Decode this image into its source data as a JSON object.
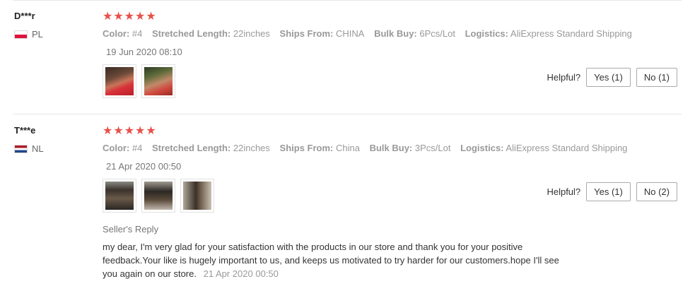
{
  "reviews": [
    {
      "user": "D***r",
      "country": "PL",
      "rating_stars": "★★★★★",
      "rating": 5,
      "attributes": [
        {
          "key": "Color:",
          "value": "#4"
        },
        {
          "key": "Stretched Length:",
          "value": "22inches"
        },
        {
          "key": "Ships From:",
          "value": "CHINA"
        },
        {
          "key": "Bulk Buy:",
          "value": "6Pcs/Lot"
        },
        {
          "key": "Logistics:",
          "value": "AliExpress Standard Shipping"
        }
      ],
      "date": "19 Jun 2020 08:10",
      "helpful_label": "Helpful?",
      "yes_label": "Yes (1)",
      "no_label": "No (1)"
    },
    {
      "user": "T***e",
      "country": "NL",
      "rating_stars": "★★★★★",
      "rating": 5,
      "attributes": [
        {
          "key": "Color:",
          "value": "#4"
        },
        {
          "key": "Stretched Length:",
          "value": "22inches"
        },
        {
          "key": "Ships From:",
          "value": "China"
        },
        {
          "key": "Bulk Buy:",
          "value": "3Pcs/Lot"
        },
        {
          "key": "Logistics:",
          "value": "AliExpress Standard Shipping"
        }
      ],
      "date": "21 Apr 2020 00:50",
      "helpful_label": "Helpful?",
      "yes_label": "Yes (1)",
      "no_label": "No (2)",
      "seller_reply": {
        "title": "Seller's Reply",
        "text": "my dear, I'm very glad for your satisfaction with the products in our store and thank you for your positive feedback.Your like is hugely important to us, and keeps us motivated to try harder for our customers.hope I'll see you again on our store.",
        "date": "21 Apr 2020 00:50"
      }
    }
  ],
  "colors": {
    "star": "#e8504a",
    "muted": "#999999",
    "border": "#e8e8e8"
  }
}
